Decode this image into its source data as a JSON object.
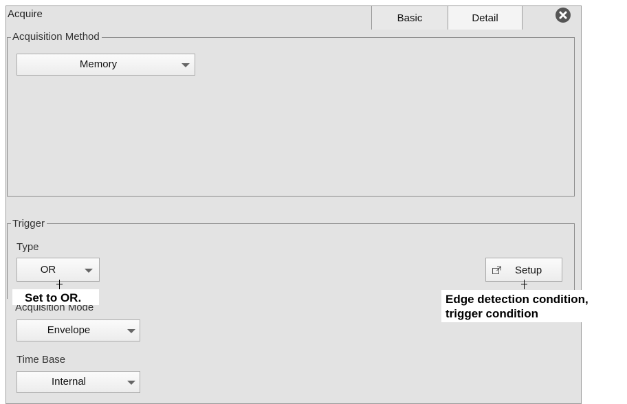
{
  "window": {
    "title": "Acquire",
    "close_icon": "close-circle-icon"
  },
  "tabs": [
    {
      "label": "Basic"
    },
    {
      "label": "Detail"
    }
  ],
  "acquisition_method": {
    "legend": "Acquisition Method",
    "value": "Memory"
  },
  "trigger": {
    "legend": "Trigger",
    "type_label": "Type",
    "type_value": "OR",
    "setup_label": "Setup",
    "setup_icon": "external-window-icon"
  },
  "acquisition_mode": {
    "label": "Acquisition Mode",
    "value": "Envelope"
  },
  "time_base": {
    "label": "Time Base",
    "value": "Internal"
  },
  "callouts": {
    "type": "Set to OR.",
    "setup_line1": "Edge detection condition,",
    "setup_line2": "trigger condition"
  }
}
